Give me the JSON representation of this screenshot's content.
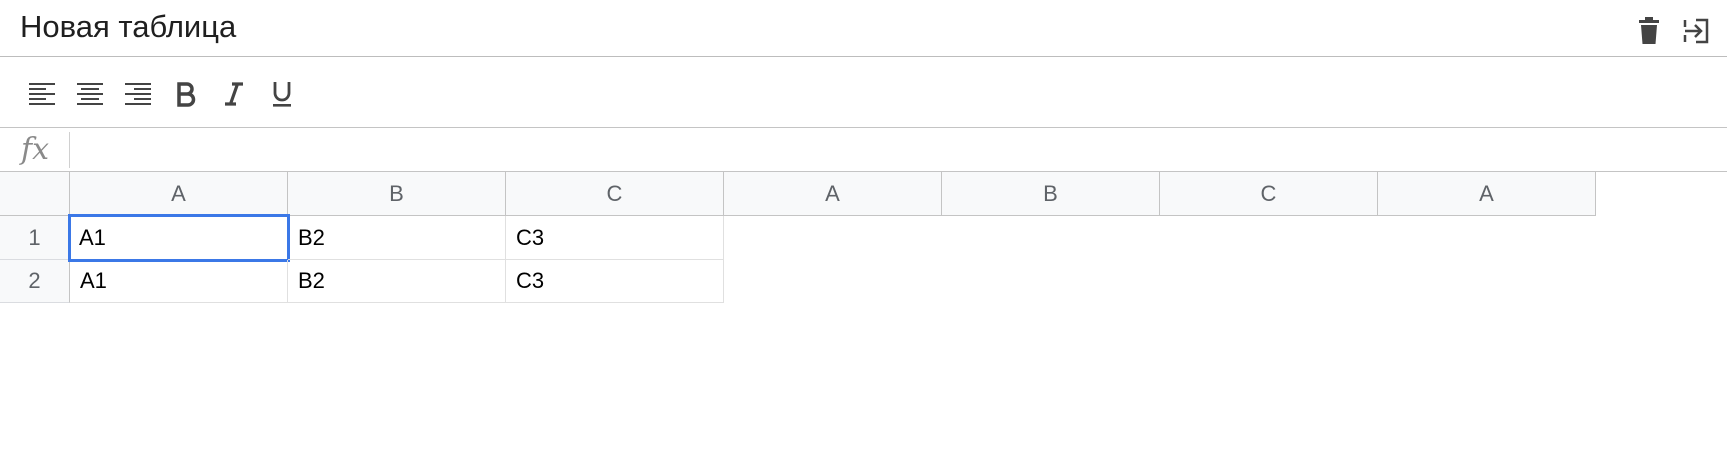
{
  "title": "Новая таблица",
  "header": {
    "icons": [
      "trash-icon",
      "exit-icon"
    ]
  },
  "toolbar": {
    "tools": [
      "align-left",
      "align-center",
      "align-right",
      "bold",
      "italic",
      "underline"
    ]
  },
  "formula_bar": {
    "label": "fx",
    "value": ""
  },
  "grid": {
    "columns": [
      "A",
      "B",
      "C",
      "A",
      "B",
      "C",
      "A"
    ],
    "rows": [
      "1",
      "2"
    ],
    "cells": [
      [
        "A1",
        "B2",
        "C3"
      ],
      [
        "A1",
        "B2",
        "C3"
      ]
    ],
    "selected_cell": "A1"
  },
  "colors": {
    "selection": "#3b78e7",
    "header_bg": "#f8f9fa"
  }
}
